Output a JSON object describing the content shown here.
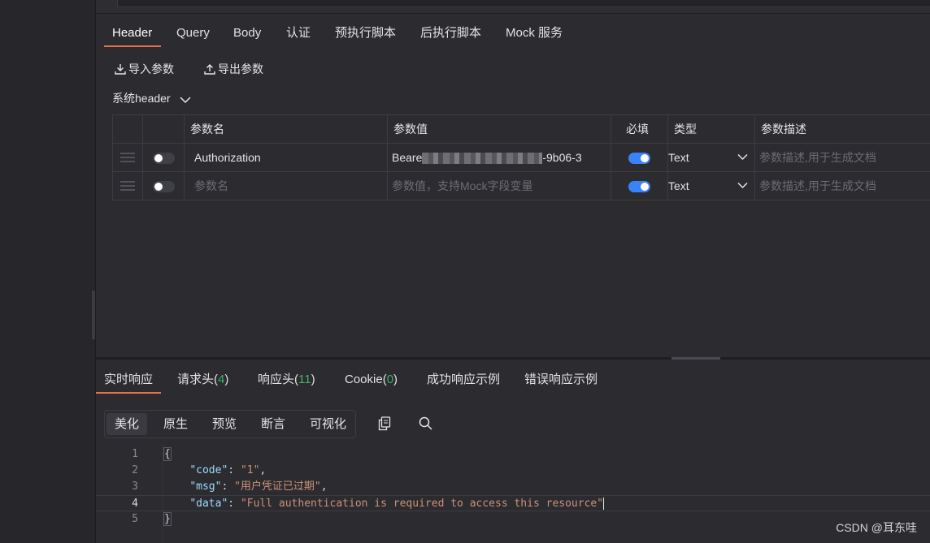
{
  "request_tabs": [
    "Header",
    "Query",
    "Body",
    "认证",
    "预执行脚本",
    "后执行脚本",
    "Mock 服务"
  ],
  "toolbar": {
    "import_label": "导入参数",
    "export_label": "导出参数"
  },
  "system_header_label": "系统header",
  "params_table": {
    "columns": [
      "参数名",
      "参数值",
      "必填",
      "类型",
      "参数描述"
    ],
    "rows": [
      {
        "enabled": false,
        "name": "Authorization",
        "value_prefix": "Beare",
        "value_suffix": "-9b06-3",
        "required": true,
        "type": "Text",
        "desc_placeholder": "参数描述,用于生成文档"
      },
      {
        "enabled": false,
        "name_placeholder": "参数名",
        "value_placeholder": "参数值，支持Mock字段变量",
        "required": true,
        "type": "Text",
        "desc_placeholder": "参数描述,用于生成文档"
      }
    ]
  },
  "response_tabs": {
    "realtime": "实时响应",
    "req_headers": "请求头(",
    "req_headers_count": "4",
    "resp_headers": "响应头(",
    "resp_headers_count": "11",
    "cookie": "Cookie(",
    "cookie_count": "0",
    "close_paren": ")",
    "success_example": "成功响应示例",
    "error_example": "错误响应示例"
  },
  "view_modes": [
    "美化",
    "原生",
    "预览",
    "断言",
    "可视化"
  ],
  "code": {
    "line_numbers": [
      "1",
      "2",
      "3",
      "4",
      "5"
    ],
    "open_brace": "{",
    "close_brace": "}",
    "code_key": "\"code\"",
    "code_val": "\"1\"",
    "msg_key": "\"msg\"",
    "msg_val": "\"用户凭证已过期\"",
    "data_key": "\"data\"",
    "data_val": "\"Full authentication is required to access this resource\""
  },
  "watermark": "CSDN @耳东哇",
  "colors": {
    "accent": "#e8714a",
    "toggle_on": "#3a82f7",
    "count_green": "#3fb36c"
  }
}
